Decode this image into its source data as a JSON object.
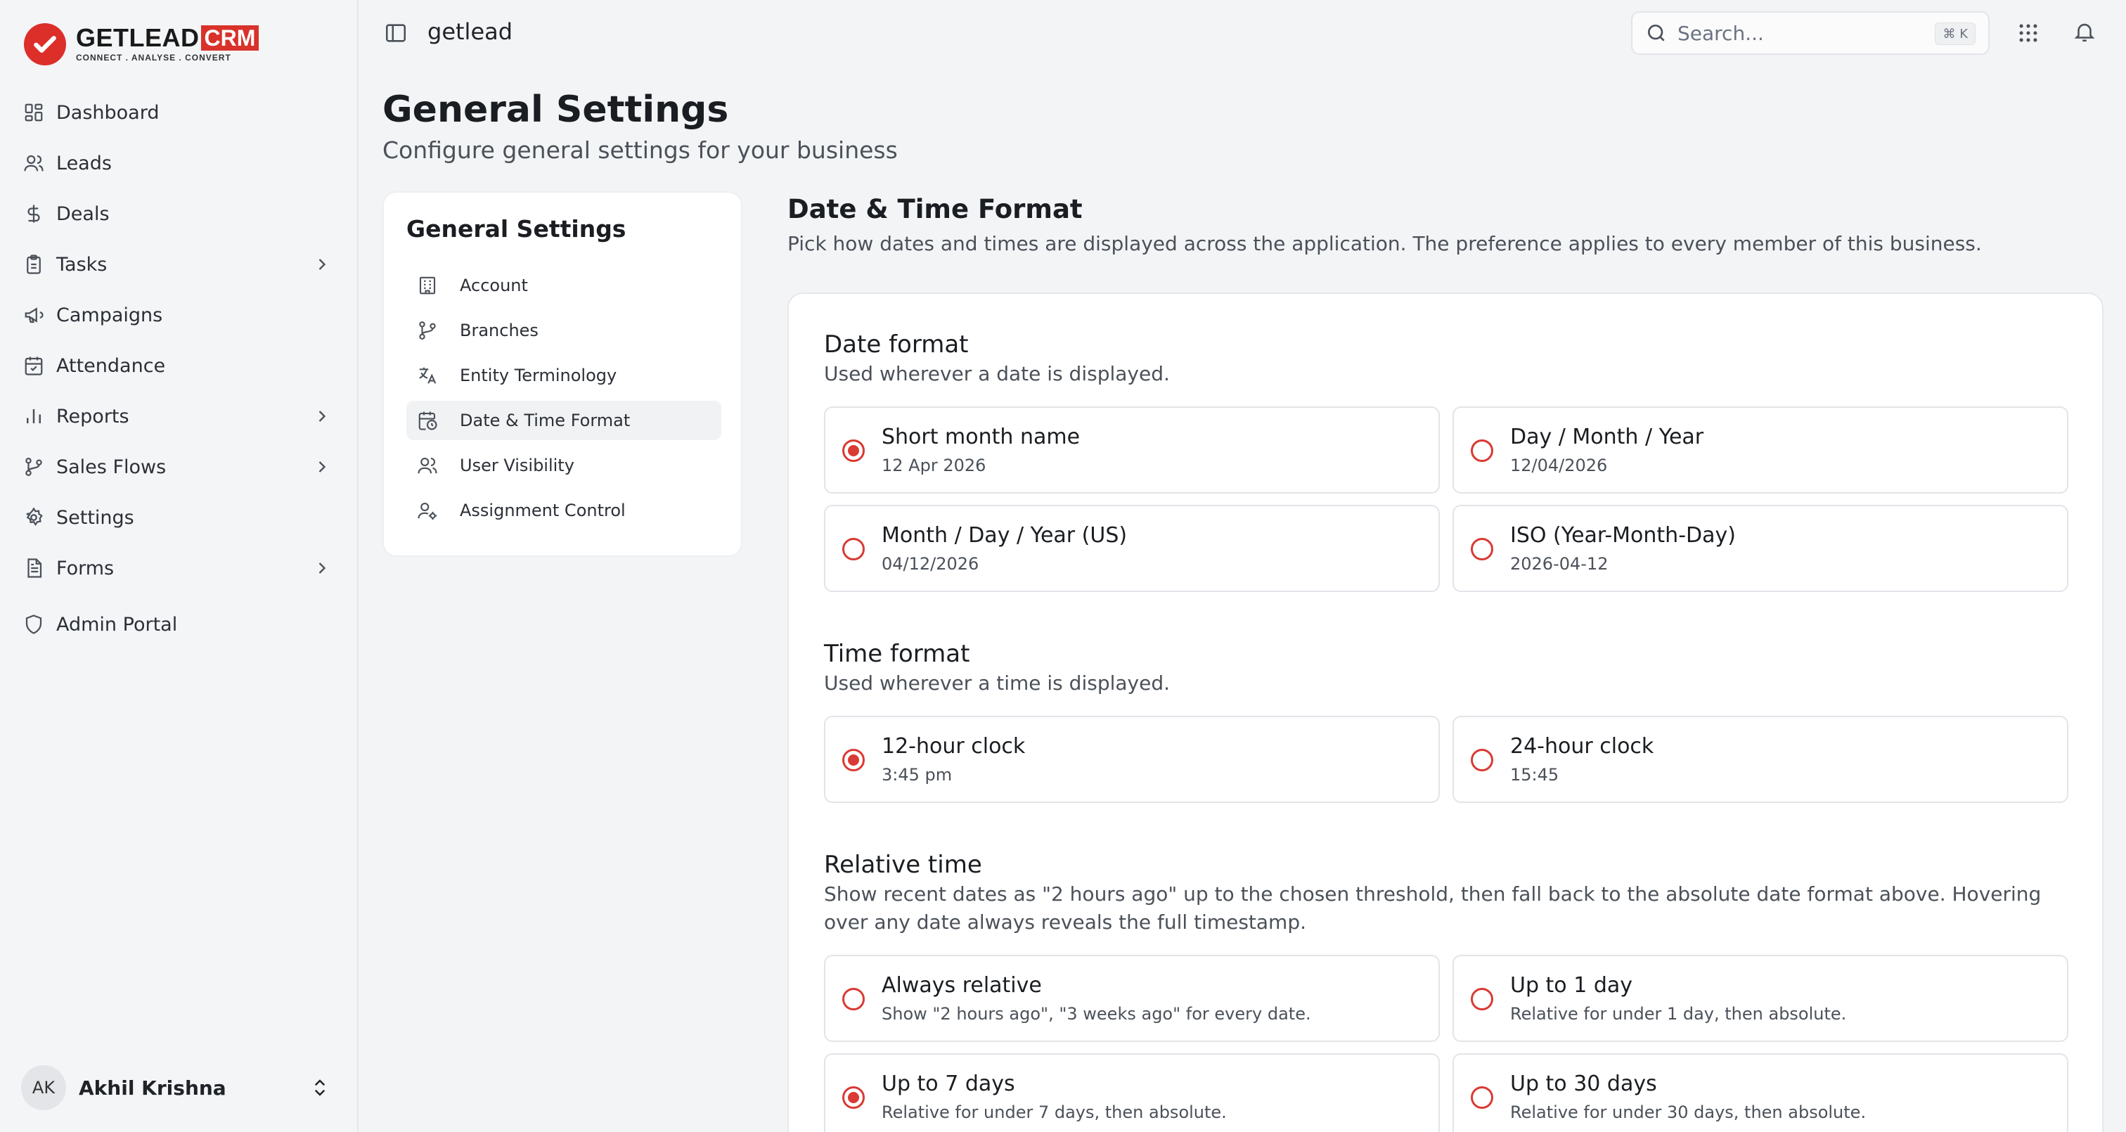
{
  "brand": {
    "name": "GETLEAD",
    "crm": "CRM",
    "tagline": "CONNECT . ANALYSE . CONVERT",
    "accent": "#d8322b"
  },
  "sidebar": {
    "items": [
      {
        "label": "Dashboard",
        "icon": "dashboard-icon"
      },
      {
        "label": "Leads",
        "icon": "users-icon"
      },
      {
        "label": "Deals",
        "icon": "dollar-icon"
      },
      {
        "label": "Tasks",
        "icon": "clipboard-icon",
        "expandable": true
      },
      {
        "label": "Campaigns",
        "icon": "megaphone-icon"
      },
      {
        "label": "Attendance",
        "icon": "calendar-check-icon"
      },
      {
        "label": "Reports",
        "icon": "bar-chart-icon",
        "expandable": true
      },
      {
        "label": "Sales Flows",
        "icon": "git-branch-icon",
        "expandable": true
      },
      {
        "label": "Settings",
        "icon": "gear-icon"
      },
      {
        "label": "Forms",
        "icon": "form-icon",
        "expandable": true
      },
      {
        "label": "Admin Portal",
        "icon": "shield-icon"
      }
    ],
    "user": {
      "initials": "AK",
      "name": "Akhil Krishna"
    }
  },
  "topbar": {
    "workspace": "getlead",
    "search_placeholder": "Search...",
    "shortcut": "⌘ K"
  },
  "page": {
    "title": "General Settings",
    "subtitle": "Configure general settings for your business"
  },
  "settings_menu": {
    "title": "General Settings",
    "items": [
      {
        "label": "Account",
        "icon": "building-icon",
        "active": false
      },
      {
        "label": "Branches",
        "icon": "branch-icon",
        "active": false
      },
      {
        "label": "Entity Terminology",
        "icon": "translate-icon",
        "active": false
      },
      {
        "label": "Date & Time Format",
        "icon": "calendar-clock-icon",
        "active": true
      },
      {
        "label": "User Visibility",
        "icon": "users-icon",
        "active": false
      },
      {
        "label": "Assignment Control",
        "icon": "user-gear-icon",
        "active": false
      }
    ]
  },
  "section": {
    "title": "Date & Time Format",
    "description": "Pick how dates and times are displayed across the application. The preference applies to every member of this business."
  },
  "date_format": {
    "title": "Date format",
    "description": "Used wherever a date is displayed.",
    "options": [
      {
        "label": "Short month name",
        "example": "12 Apr 2026",
        "selected": true
      },
      {
        "label": "Day / Month / Year",
        "example": "12/04/2026",
        "selected": false
      },
      {
        "label": "Month / Day / Year (US)",
        "example": "04/12/2026",
        "selected": false
      },
      {
        "label": "ISO (Year-Month-Day)",
        "example": "2026-04-12",
        "selected": false
      }
    ]
  },
  "time_format": {
    "title": "Time format",
    "description": "Used wherever a time is displayed.",
    "options": [
      {
        "label": "12-hour clock",
        "example": "3:45 pm",
        "selected": true
      },
      {
        "label": "24-hour clock",
        "example": "15:45",
        "selected": false
      }
    ]
  },
  "relative_time": {
    "title": "Relative time",
    "description": "Show recent dates as \"2 hours ago\" up to the chosen threshold, then fall back to the absolute date format above. Hovering over any date always reveals the full timestamp.",
    "options": [
      {
        "label": "Always relative",
        "example": "Show \"2 hours ago\", \"3 weeks ago\" for every date.",
        "selected": false
      },
      {
        "label": "Up to 1 day",
        "example": "Relative for under 1 day, then absolute.",
        "selected": false
      },
      {
        "label": "Up to 7 days",
        "example": "Relative for under 7 days, then absolute.",
        "selected": true
      },
      {
        "label": "Up to 30 days",
        "example": "Relative for under 30 days, then absolute.",
        "selected": false
      }
    ]
  }
}
